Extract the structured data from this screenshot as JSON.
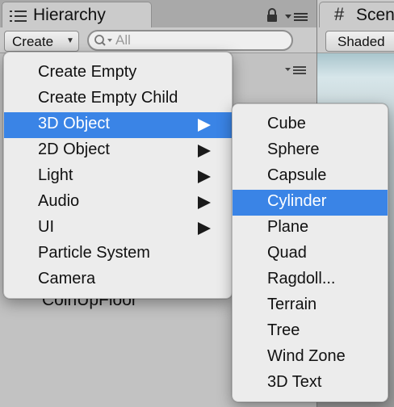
{
  "hierarchy": {
    "tab_title": "Hierarchy",
    "create_label": "Create",
    "search_placeholder": "All",
    "background_item": "CoinUpFloor"
  },
  "scene": {
    "tab_title": "Scene",
    "shading_mode": "Shaded"
  },
  "create_menu": {
    "items": [
      {
        "label": "Create Empty",
        "submenu": false,
        "selected": false
      },
      {
        "label": "Create Empty Child",
        "submenu": false,
        "selected": false
      },
      {
        "label": "3D Object",
        "submenu": true,
        "selected": true
      },
      {
        "label": "2D Object",
        "submenu": true,
        "selected": false
      },
      {
        "label": "Light",
        "submenu": true,
        "selected": false
      },
      {
        "label": "Audio",
        "submenu": true,
        "selected": false
      },
      {
        "label": "UI",
        "submenu": true,
        "selected": false
      },
      {
        "label": "Particle System",
        "submenu": false,
        "selected": false
      },
      {
        "label": "Camera",
        "submenu": false,
        "selected": false
      }
    ]
  },
  "object_3d_menu": {
    "items": [
      {
        "label": "Cube",
        "selected": false
      },
      {
        "label": "Sphere",
        "selected": false
      },
      {
        "label": "Capsule",
        "selected": false
      },
      {
        "label": "Cylinder",
        "selected": true
      },
      {
        "label": "Plane",
        "selected": false
      },
      {
        "label": "Quad",
        "selected": false
      },
      {
        "label": "Ragdoll...",
        "selected": false
      },
      {
        "label": "Terrain",
        "selected": false
      },
      {
        "label": "Tree",
        "selected": false
      },
      {
        "label": "Wind Zone",
        "selected": false
      },
      {
        "label": "3D Text",
        "selected": false
      }
    ]
  },
  "colors": {
    "selection": "#3a84e6",
    "menu_background": "#ececec",
    "panel_background": "#c2c2c2"
  }
}
